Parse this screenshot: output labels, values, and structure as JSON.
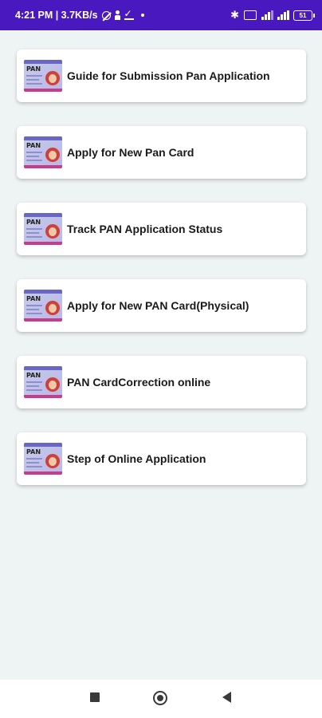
{
  "status_bar": {
    "left_text": "4:21 PM | 3.7KB/s",
    "battery_level": "51",
    "icons_left": [
      "alarm-off-icon",
      "person-icon",
      "download-icon",
      "dot-icon"
    ],
    "icons_right": [
      "bluetooth-icon",
      "vpn-box-icon",
      "signal-icon",
      "wifi-signal-icon",
      "battery-icon"
    ]
  },
  "menu": {
    "items": [
      {
        "label": "Guide for Submission Pan Application",
        "icon": "pan-card-icon"
      },
      {
        "label": "Apply for New Pan Card",
        "icon": "pan-card-icon"
      },
      {
        "label": "Track PAN Application Status",
        "icon": "pan-card-icon"
      },
      {
        "label": "Apply for New PAN Card(Physical)",
        "icon": "pan-card-icon"
      },
      {
        "label": "PAN CardCorrection online",
        "icon": "pan-card-icon"
      },
      {
        "label": "Step of Online Application",
        "icon": "pan-card-icon"
      }
    ],
    "icon_text": "PAN"
  },
  "nav_bar": {
    "buttons": [
      "recent-apps-icon",
      "home-icon",
      "back-icon"
    ]
  },
  "colors": {
    "status_bar": "#4a18bf",
    "background": "#eef3f3",
    "card": "#ffffff"
  }
}
